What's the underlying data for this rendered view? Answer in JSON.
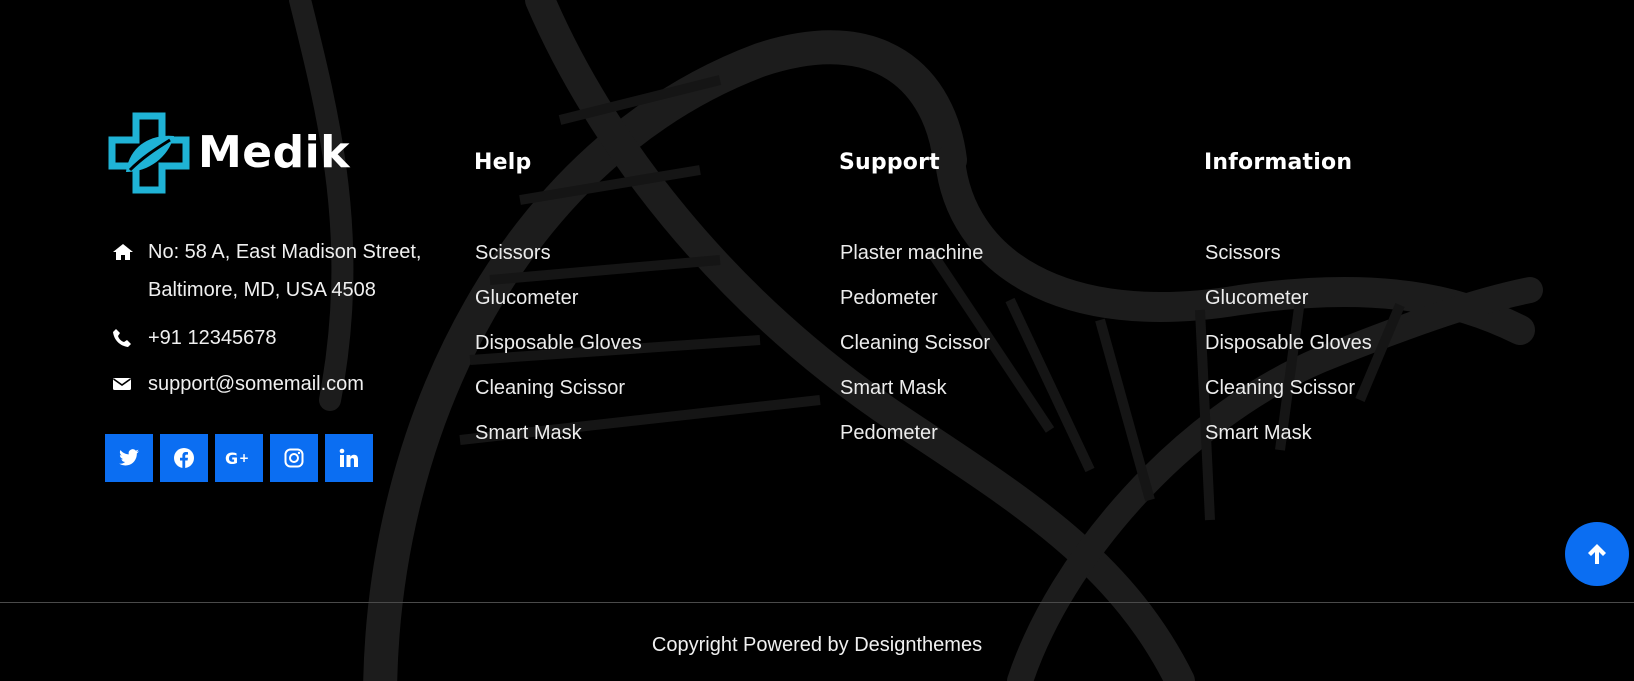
{
  "brand": {
    "name": "Medik",
    "logo_icon": "medical-cross-leaf-icon"
  },
  "contact": {
    "address_line1": "No: 58 A, East Madison Street,",
    "address_line2": "Baltimore, MD, USA 4508",
    "phone": "+91 12345678",
    "email": "support@somemail.com"
  },
  "socials": [
    {
      "icon": "twitter-icon"
    },
    {
      "icon": "facebook-icon"
    },
    {
      "icon": "google-plus-icon"
    },
    {
      "icon": "instagram-icon"
    },
    {
      "icon": "linkedin-icon"
    }
  ],
  "columns": {
    "help": {
      "title": "Help",
      "items": [
        "Scissors",
        "Glucometer",
        "Disposable Gloves",
        "Cleaning Scissor",
        "Smart Mask"
      ]
    },
    "support": {
      "title": "Support",
      "items": [
        "Plaster machine",
        "Pedometer",
        "Cleaning Scissor",
        "Smart Mask",
        "Pedometer"
      ]
    },
    "information": {
      "title": "Information",
      "items": [
        "Scissors",
        "Glucometer",
        "Disposable Gloves",
        "Cleaning Scissor",
        "Smart Mask"
      ]
    }
  },
  "copyright": "Copyright Powered by Designthemes",
  "colors": {
    "accent": "#0b6ef2",
    "background": "#000000",
    "logo_teal": "#1fb3d6"
  }
}
